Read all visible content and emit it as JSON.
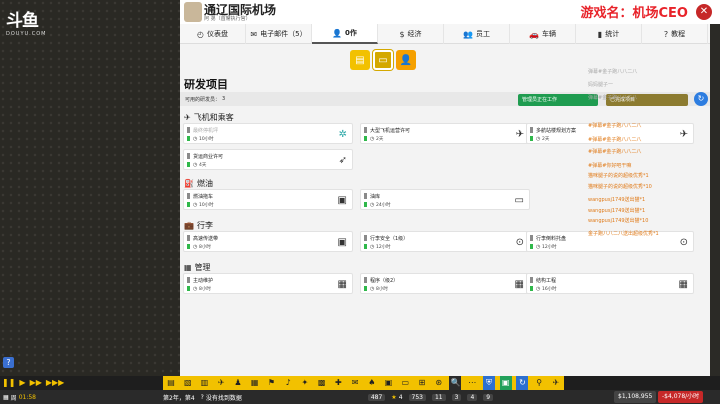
{
  "stream": {
    "logo_text": "斗鱼",
    "logo_sub": "DOUYU.COM",
    "title_overlay": "游戏名：机场CEO"
  },
  "header": {
    "airport_name": "通辽国际机场",
    "airport_sub": "阿 弟（首席执行官）"
  },
  "nav": {
    "tabs": [
      {
        "label": "仪表盘",
        "icon": "dashboard-icon",
        "glyph": "◴"
      },
      {
        "label": "电子邮件（5）",
        "icon": "envelope-icon",
        "glyph": "✉"
      },
      {
        "label": "0作",
        "icon": "person-icon",
        "glyph": "👤",
        "active": true
      },
      {
        "label": "经济",
        "icon": "money-icon",
        "glyph": "$"
      },
      {
        "label": "员工",
        "icon": "staff-icon",
        "glyph": "👥"
      },
      {
        "label": "车辆",
        "icon": "car-icon",
        "glyph": "🚗"
      },
      {
        "label": "统计",
        "icon": "bar-chart-icon",
        "glyph": "▮"
      },
      {
        "label": "教程",
        "icon": "question-icon",
        "glyph": "?"
      }
    ]
  },
  "subtabs": [
    {
      "icon": "chart-icon",
      "glyph": "▤"
    },
    {
      "icon": "laptop-icon",
      "glyph": "▭"
    },
    {
      "icon": "person-icon",
      "glyph": "👤"
    }
  ],
  "research": {
    "title": "研发项目",
    "researchers_label": "可用的研发员：",
    "researchers_value": "3",
    "categories": [
      {
        "name": "飞机和乘客",
        "icon": "airplane-icon",
        "glyph": "✈",
        "items": [
          {
            "name": "最终停机坪",
            "time": "10小时",
            "pic": "✲",
            "dim": true
          },
          {
            "name": "大型飞机运营许可",
            "time": "2天",
            "pic": "✈"
          },
          {
            "name": "多航站楼规划方案",
            "time": "2天",
            "pic": "✈"
          },
          {
            "name": "货运商业许可",
            "time": "4天",
            "pic": "➶"
          }
        ]
      },
      {
        "name": "燃油",
        "icon": "fuel-icon",
        "glyph": "⛽",
        "items": [
          {
            "name": "燃油拖车",
            "time": "10小时",
            "pic": "▣"
          },
          {
            "name": "油库",
            "time": "24小时",
            "pic": "▭"
          }
        ]
      },
      {
        "name": "行李",
        "icon": "luggage-icon",
        "glyph": "💼",
        "items": [
          {
            "name": "高速传送带",
            "time": "8小时",
            "pic": "▣"
          },
          {
            "name": "行李安全（1级）",
            "time": "12小时",
            "pic": "⊙"
          },
          {
            "name": "行李倒料托盘",
            "time": "12小时",
            "pic": "⊙"
          }
        ]
      },
      {
        "name": "管理",
        "icon": "building-icon",
        "glyph": "▦",
        "items": [
          {
            "name": "主动维护",
            "time": "8小时",
            "pic": "▦"
          },
          {
            "name": "程序（级2）",
            "time": "8小时",
            "pic": "▦"
          },
          {
            "name": "结构工程",
            "time": "16小时",
            "pic": "▦"
          }
        ]
      }
    ]
  },
  "feed": {
    "btn_staff": "管理员正在工作",
    "btn_done": "已完成项目",
    "lines": [
      {
        "text": "弹幕#金子跑八八二八",
        "c": "gray"
      },
      {
        "text": "妈妈腿子一",
        "c": "gray"
      },
      {
        "text": "弹幕#金子跑八八二八",
        "c": "gray"
      },
      {
        "text": "#弹幕#金子跑八八二八",
        "c": "orange"
      },
      {
        "text": "#弹幕#金子跑八八二八",
        "c": "orange"
      },
      {
        "text": "#弹幕#金子跑八八二八",
        "c": "orange"
      },
      {
        "text": "#弹幕#你好吧干嘛",
        "c": "orange"
      },
      {
        "text": "猫咪腿子的说的超级优秀*1",
        "c": "orange"
      },
      {
        "text": "猫咪腿子的说的超级优秀*10",
        "c": "orange"
      },
      {
        "text": "wangpusj1749送出猫*1",
        "c": "orange"
      },
      {
        "text": "wangpusj1749送出猫*1",
        "c": "orange"
      },
      {
        "text": "wangpusj1749送出猫*10",
        "c": "orange"
      },
      {
        "text": "金子跑八八二八送出超级优秀*1",
        "c": "orange"
      }
    ]
  },
  "statusbar": {
    "date_label": "周",
    "time": "01:58",
    "year": "第2年，第4",
    "message": "没有找到数据",
    "passengers": "487",
    "stars": "4",
    "count1": "753",
    "count2": "11",
    "count3": "3",
    "count4": "4",
    "count5": "9",
    "money": "$1,108,955",
    "rate": "-$4,078/小时"
  }
}
